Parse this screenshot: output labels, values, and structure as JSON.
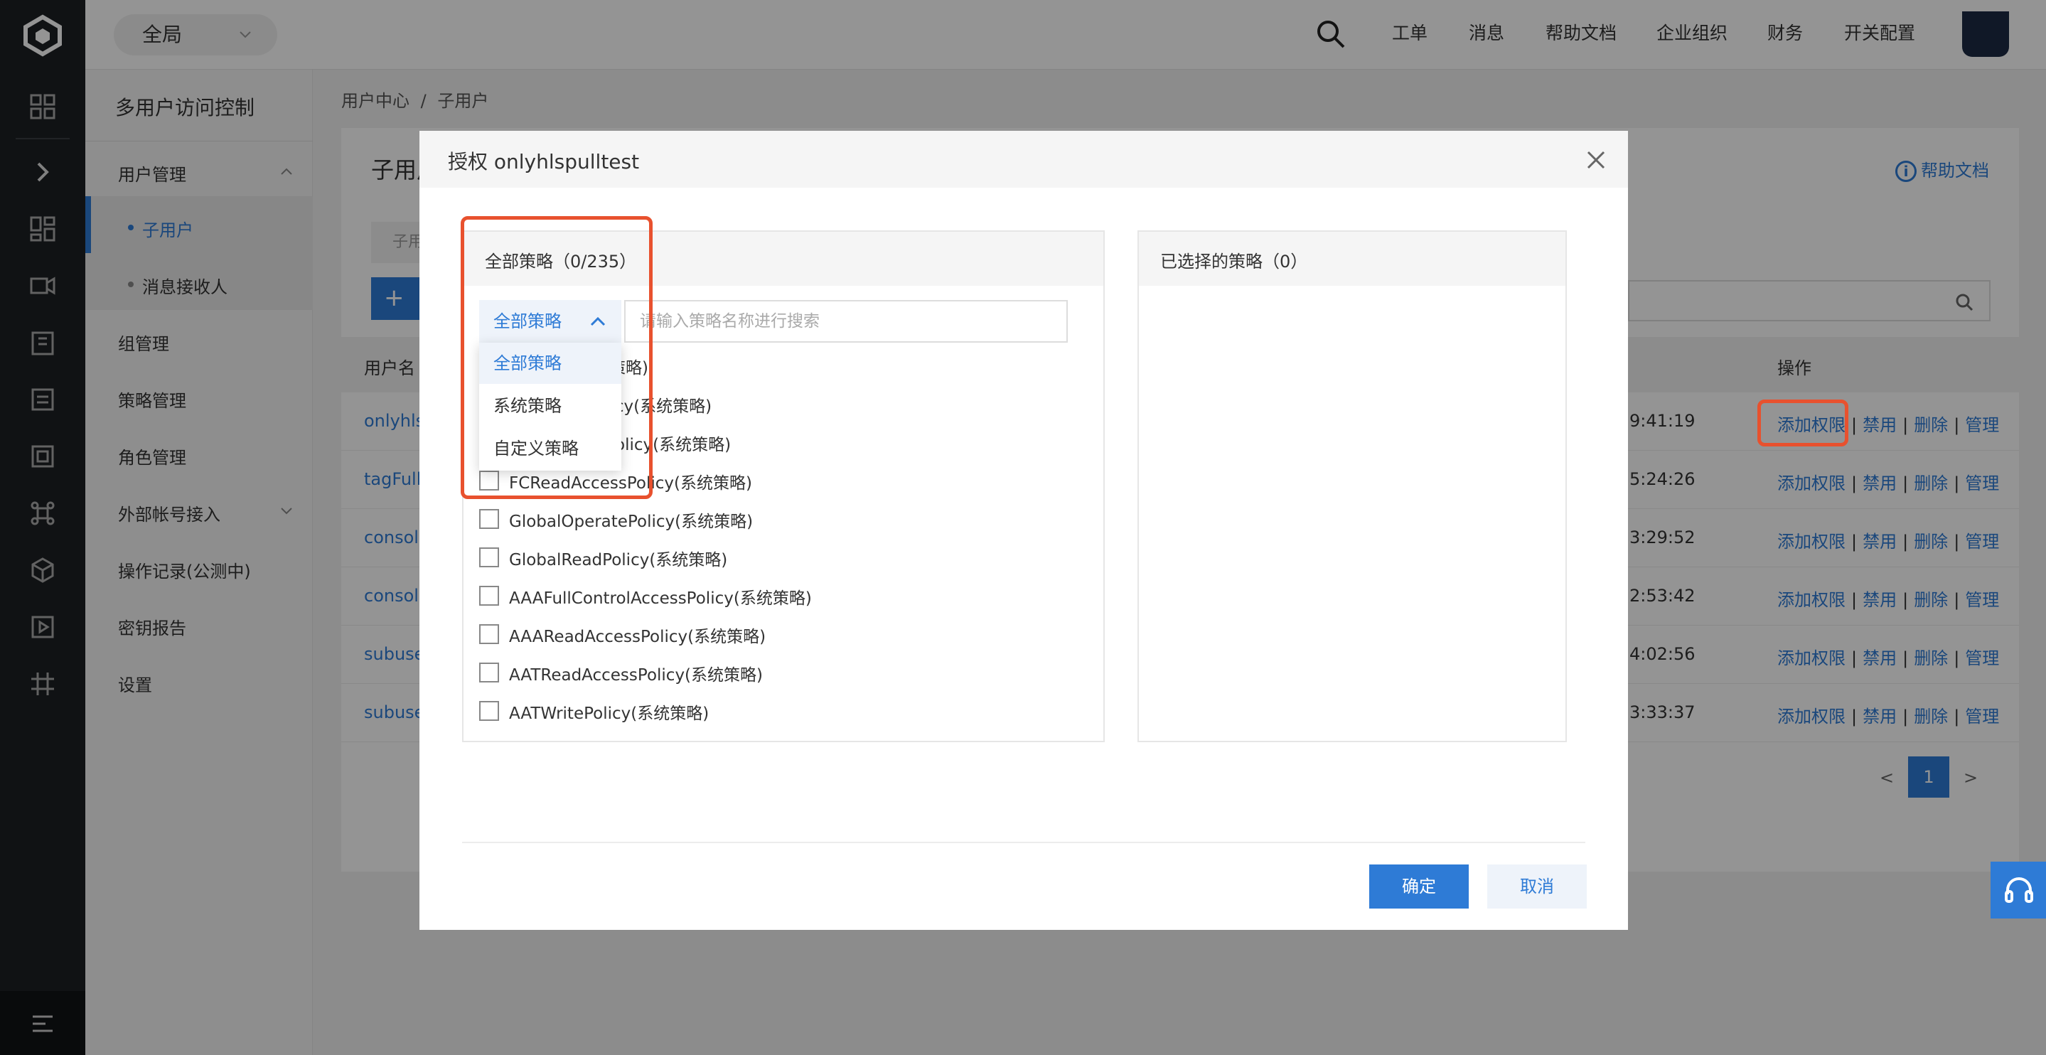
{
  "topbar": {
    "scope": "全局",
    "nav": [
      "工单",
      "消息",
      "帮助文档",
      "企业组织",
      "财务",
      "开关配置"
    ]
  },
  "sidebar": {
    "title": "多用户访问控制",
    "user_mgmt": "用户管理",
    "sub_users": "子用户",
    "msg_receivers": "消息接收人",
    "items": [
      "组管理",
      "策略管理",
      "角色管理",
      "外部帐号接入",
      "操作记录(公测中)",
      "密钥报告",
      "设置"
    ]
  },
  "breadcrumb": {
    "root": "用户中心",
    "sep": "/",
    "current": "子用户"
  },
  "panel": {
    "title_partial": "子用户",
    "help": "帮助文档",
    "filter_partial": "子用",
    "create_plus": "+",
    "table": {
      "headers": {
        "name": "用户名",
        "ops": "操作"
      },
      "rows": [
        {
          "name": "onlyhls",
          "time": "9:41:19"
        },
        {
          "name": "tagFull",
          "time": "5:24:26"
        },
        {
          "name": "console",
          "time": "3:29:52"
        },
        {
          "name": "console",
          "time": "2:53:42"
        },
        {
          "name": "subuse",
          "time": "4:02:56"
        },
        {
          "name": "subuse",
          "time": "3:33:37"
        }
      ],
      "ops": {
        "add": "添加权限",
        "disable": "禁用",
        "delete": "删除",
        "manage": "管理",
        "sep": "|"
      }
    },
    "pager": {
      "prev": "<",
      "page": "1",
      "next": ">"
    }
  },
  "modal": {
    "title": "授权 onlyhlspulltest",
    "all_header": "全部策略（0/235）",
    "selected_header": "已选择的策略（0）",
    "filter_value": "全部策略",
    "search_placeholder": "请输入策略名称进行搜索",
    "menu": [
      "全部策略",
      "系统策略",
      "自定义策略"
    ],
    "policies": [
      "统策略)",
      "olicy(系统策略)",
      "sPolicy(系统策略)",
      "FCReadAccessPolicy(系统策略)",
      "GlobalOperatePolicy(系统策略)",
      "GlobalReadPolicy(系统策略)",
      "AAAFullControlAccessPolicy(系统策略)",
      "AAAReadAccessPolicy(系统策略)",
      "AATReadAccessPolicy(系统策略)",
      "AATWritePolicy(系统策略)"
    ],
    "ok": "确定",
    "cancel": "取消"
  },
  "colors": {
    "accent": "#2e7bd6",
    "annotation": "#e8512e",
    "rail": "#1c1f24"
  }
}
